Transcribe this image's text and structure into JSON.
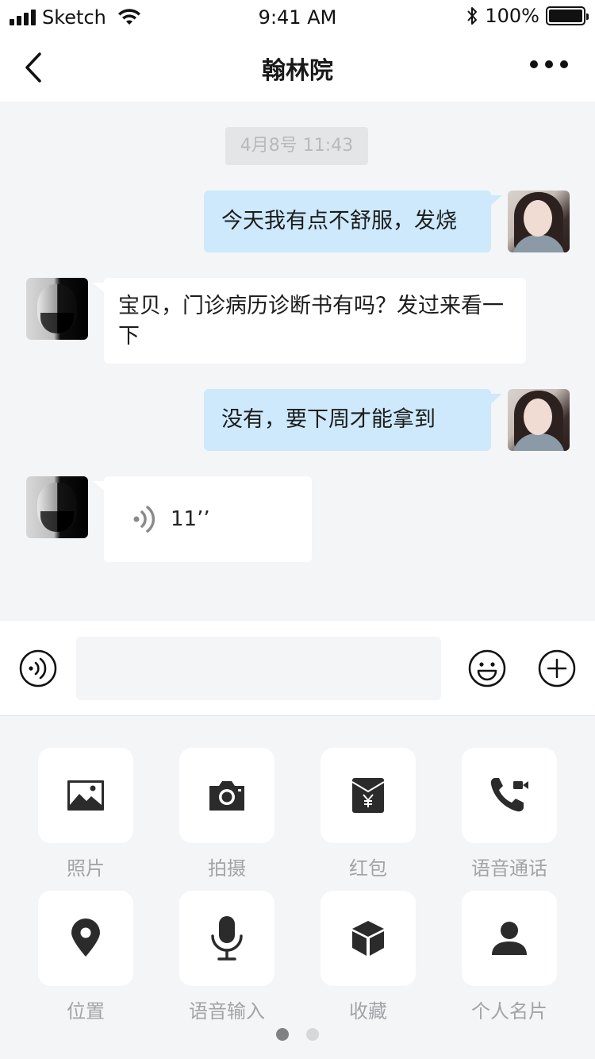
{
  "status_bar": {
    "carrier": "Sketch",
    "time": "9:41 AM",
    "battery": "100%"
  },
  "nav": {
    "title": "翰林院"
  },
  "chat": {
    "timestamp": "4月8号 11:43",
    "messages": [
      {
        "sender": "self",
        "type": "text",
        "text": "今天我有点不舒服，发烧"
      },
      {
        "sender": "doctor",
        "type": "text",
        "text": "宝贝，门诊病历诊断书有吗？发过来看一下"
      },
      {
        "sender": "self",
        "type": "text",
        "text": "没有，要下周才能拿到"
      },
      {
        "sender": "doctor",
        "type": "voice",
        "duration": "11’’"
      }
    ]
  },
  "input_bar": {
    "placeholder": ""
  },
  "tools": [
    {
      "label": "照片",
      "icon": "photo-icon"
    },
    {
      "label": "拍摄",
      "icon": "camera-icon"
    },
    {
      "label": "红包",
      "icon": "red-packet-icon"
    },
    {
      "label": "语音通话",
      "icon": "voice-call-icon"
    },
    {
      "label": "位置",
      "icon": "location-icon"
    },
    {
      "label": "语音输入",
      "icon": "microphone-icon"
    },
    {
      "label": "收藏",
      "icon": "favorites-box-icon"
    },
    {
      "label": "个人名片",
      "icon": "contact-card-icon"
    }
  ],
  "pager": {
    "pages": 2,
    "current": 1
  },
  "colors": {
    "outgoing_bubble": "#cde9fb",
    "incoming_bubble": "#ffffff",
    "background": "#f4f5f7"
  }
}
